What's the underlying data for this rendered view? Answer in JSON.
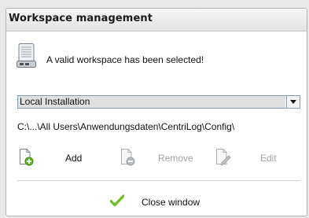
{
  "panel": {
    "title": "Workspace management"
  },
  "status": {
    "icon": "workspace-server-icon",
    "message": "A valid workspace has been selected!"
  },
  "workspace_select": {
    "selected": "Local Installation"
  },
  "path": "C:\\...\\All Users\\Anwendungsdaten\\CentriLog\\Config\\",
  "actions": {
    "add_label": "Add",
    "remove_label": "Remove",
    "edit_label": "Edit"
  },
  "close_label": "Close window",
  "colors": {
    "disabled_text": "#a0a0a0",
    "select_border": "#7f9db9",
    "check_green": "#6cc022"
  }
}
